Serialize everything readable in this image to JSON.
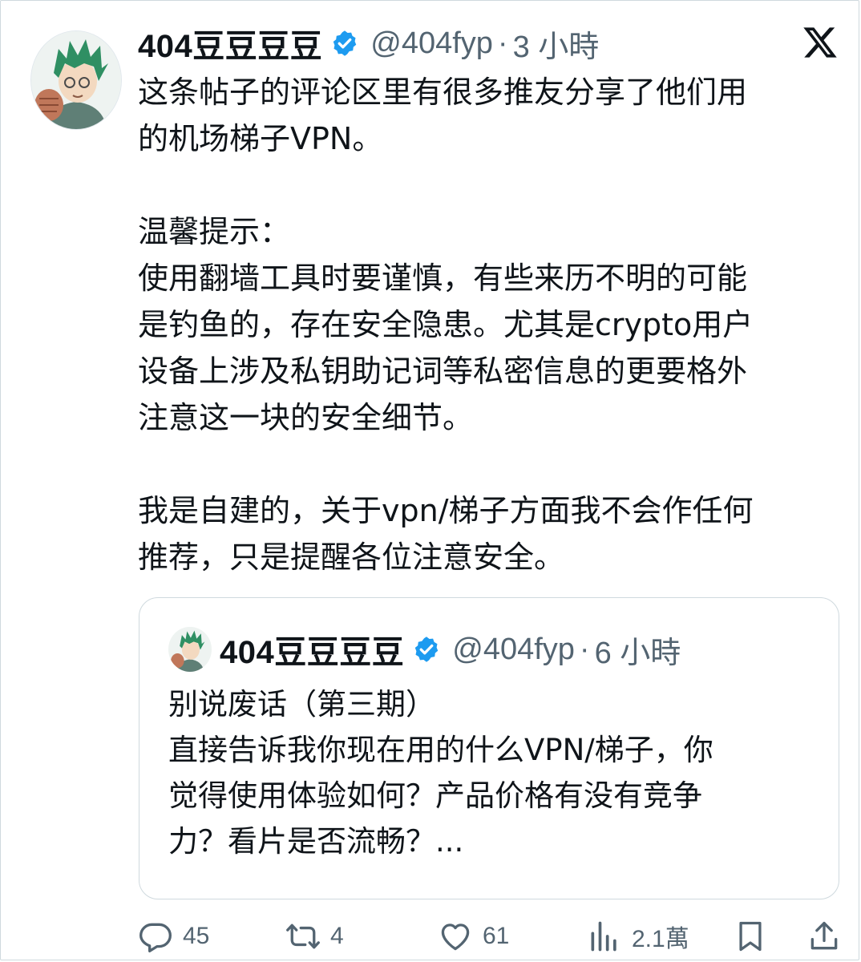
{
  "tweet": {
    "display_name": "404豆豆豆豆",
    "handle": "@404fyp",
    "separator": "·",
    "time": "3 小時",
    "text": "这条帖子的评论区里有很多推友分享了他们用\n的机场梯子VPN。\n\n温馨提示：\n使用翻墙工具时要谨慎，有些来历不明的可能\n是钓鱼的，存在安全隐患。尤其是crypto用户\n设备上涉及私钥助记词等私密信息的更要格外\n注意这一块的安全细节。\n\n我是自建的，关于vpn/梯子方面我不会作任何\n推荐，只是提醒各位注意安全。",
    "verified": true,
    "logo_icon": "x-logo-icon",
    "avatar_icon": "avatar-icon"
  },
  "quoted": {
    "display_name": "404豆豆豆豆",
    "handle": "@404fyp",
    "separator": "·",
    "time": "6 小時",
    "text": "别说废话（第三期）\n直接告诉我你现在用的什么VPN/梯子，你\n觉得使用体验如何？产品价格有没有竞争\n力？看片是否流畅？...",
    "verified": true
  },
  "actions": {
    "replies": "45",
    "retweets": "4",
    "likes": "61",
    "views": "2.1萬"
  },
  "colors": {
    "verified_blue": "#1d9bf0",
    "muted_gray": "#536471",
    "text": "#0f1419",
    "border": "#cfd9de"
  }
}
